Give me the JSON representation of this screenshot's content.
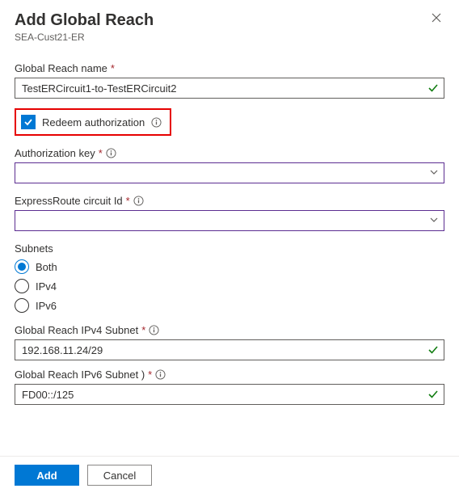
{
  "header": {
    "title": "Add Global Reach",
    "subtitle": "SEA-Cust21-ER"
  },
  "fields": {
    "globalReachName": {
      "label": "Global Reach name",
      "value": "TestERCircuit1-to-TestERCircuit2"
    },
    "redeem": {
      "label": "Redeem authorization",
      "checked": true
    },
    "authKey": {
      "label": "Authorization key",
      "value": ""
    },
    "circuitId": {
      "label": "ExpressRoute circuit Id",
      "value": ""
    },
    "subnetsLabel": "Subnets",
    "subnets": {
      "both": "Both",
      "ipv4": "IPv4",
      "ipv6": "IPv6",
      "selected": "both"
    },
    "ipv4Subnet": {
      "label": "Global Reach IPv4 Subnet",
      "value": "192.168.11.24/29"
    },
    "ipv6Subnet": {
      "label": "Global Reach IPv6 Subnet )",
      "value": "FD00::/125"
    }
  },
  "footer": {
    "add": "Add",
    "cancel": "Cancel"
  }
}
